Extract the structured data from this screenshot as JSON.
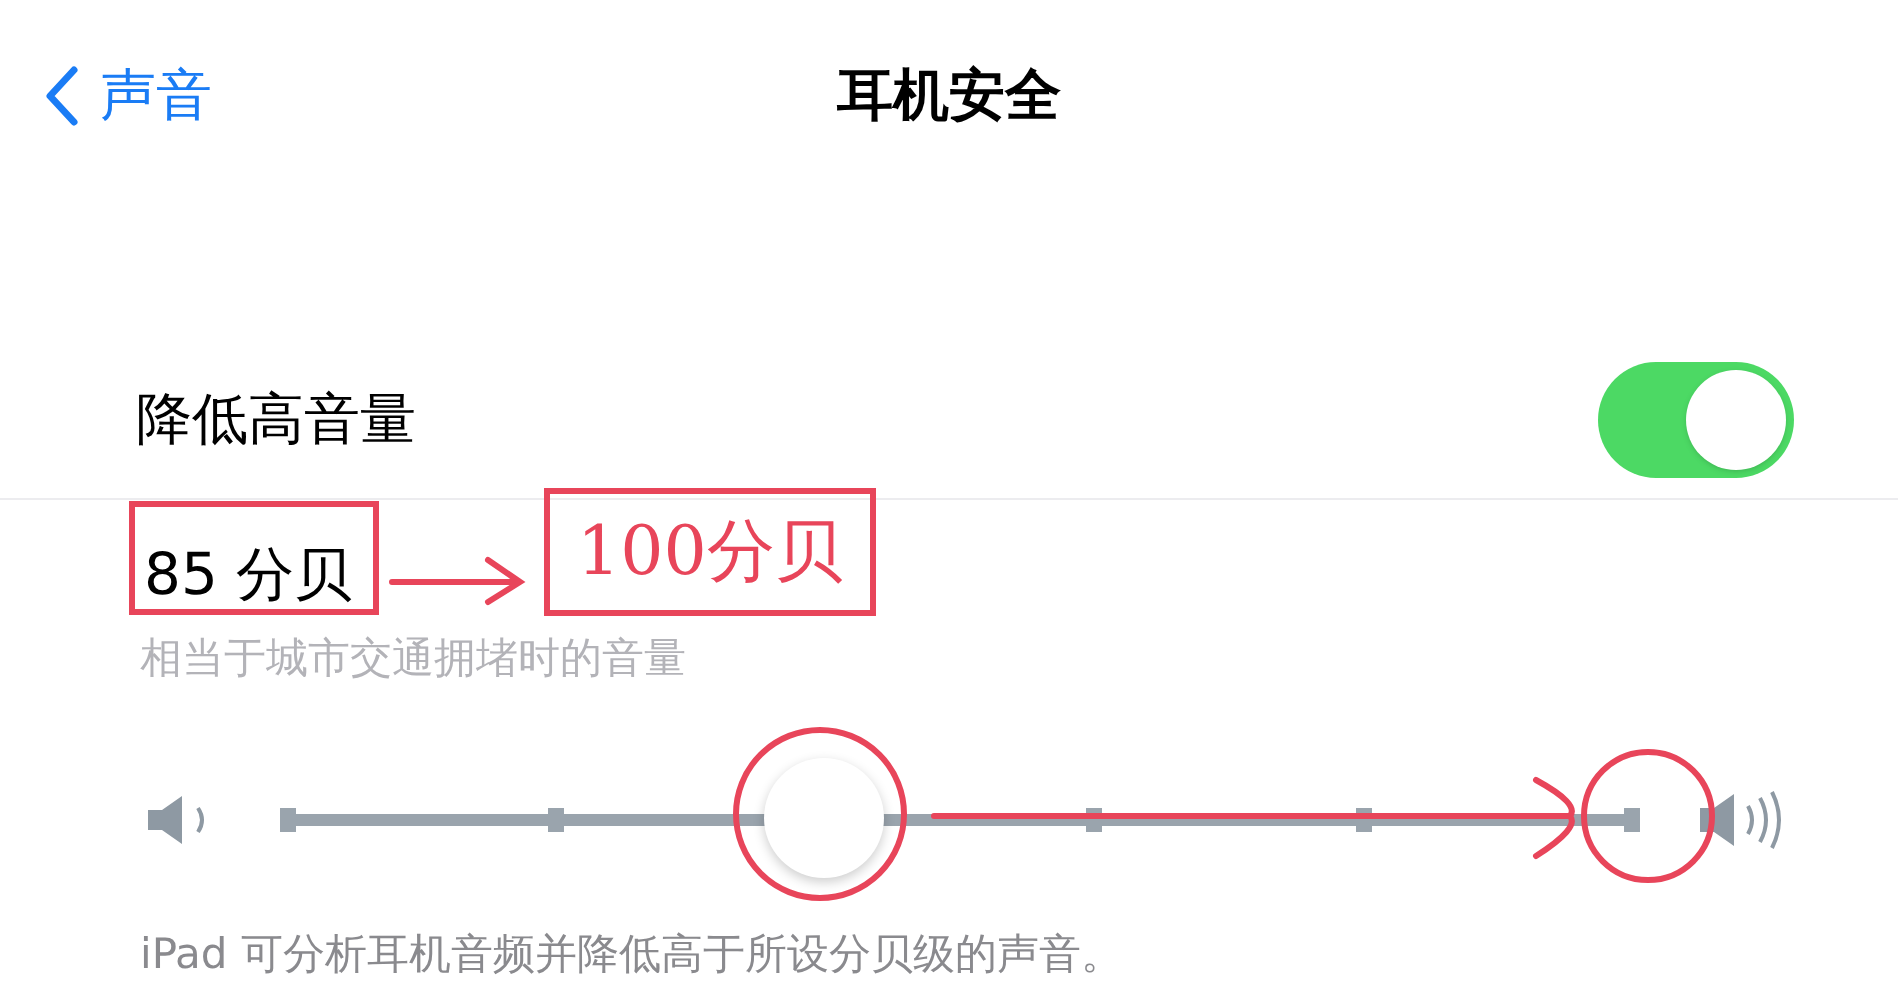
{
  "nav": {
    "back_label": "声音",
    "title": "耳机安全"
  },
  "toggle_row": {
    "label": "降低高音量",
    "on": true
  },
  "level_value": "85 分贝",
  "level_description": "相当于城市交通拥堵时的音量",
  "slider": {
    "level": 0.4
  },
  "footer": "iPad 可分析耳机音频并降低高于所设分贝级的声音。",
  "annotation": {
    "note": "100分贝",
    "color": "#e8455a"
  }
}
